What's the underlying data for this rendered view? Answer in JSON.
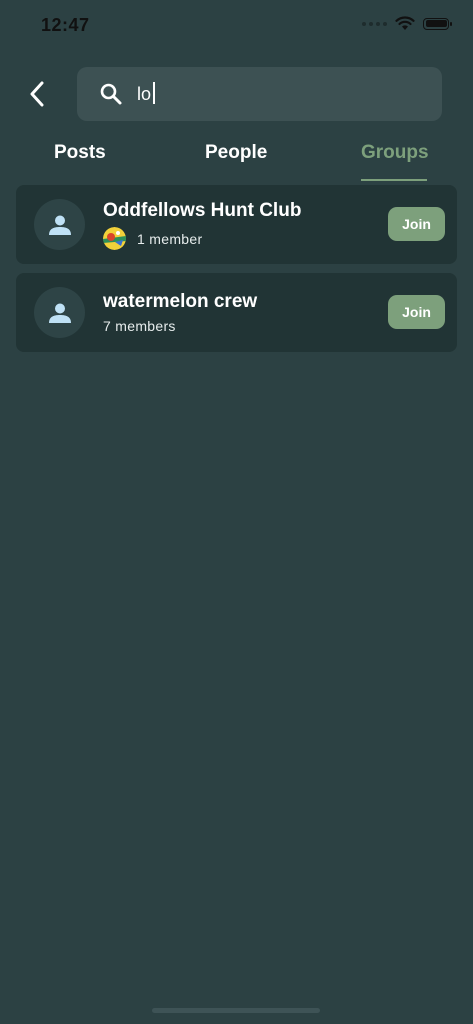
{
  "status_bar": {
    "time": "12:47"
  },
  "search": {
    "query": "lo",
    "placeholder": ""
  },
  "tabs": [
    {
      "label": "Posts",
      "active": false
    },
    {
      "label": "People",
      "active": false
    },
    {
      "label": "Groups",
      "active": true
    }
  ],
  "groups": [
    {
      "name": "Oddfellows Hunt Club",
      "members": "1 member",
      "join_label": "Join"
    },
    {
      "name": "watermelon crew",
      "members": "7 members",
      "join_label": "Join"
    }
  ],
  "colors": {
    "background": "#2c4143",
    "card": "#213435",
    "accent": "#7da07c",
    "search_field": "#3d5153"
  },
  "icons": [
    "back-arrow-icon",
    "search-icon",
    "person-icon",
    "wifi-icon",
    "battery-icon"
  ]
}
